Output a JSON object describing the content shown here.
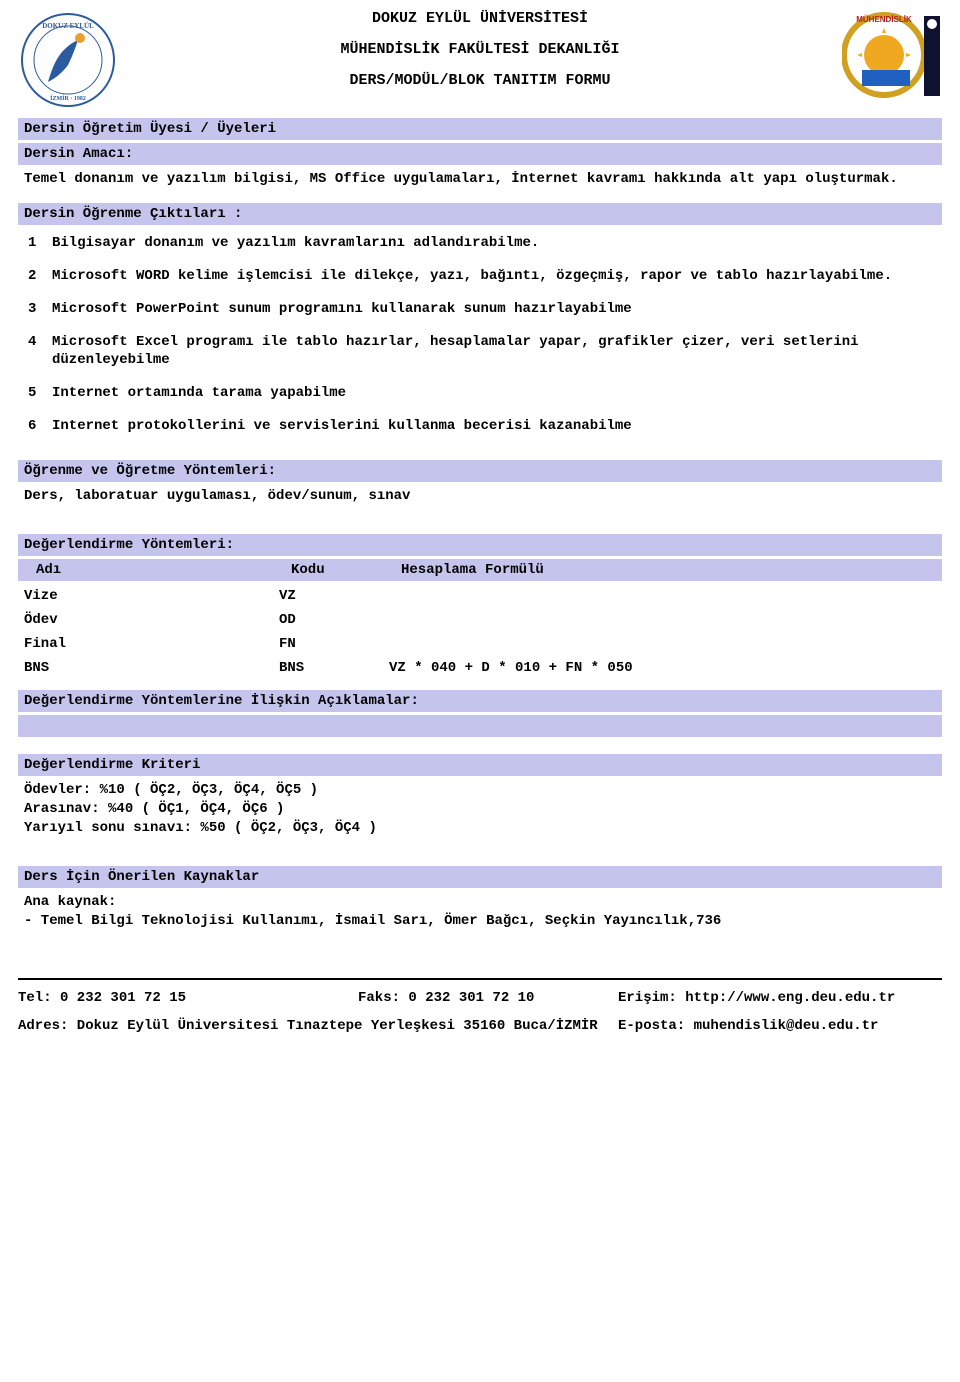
{
  "header": {
    "title1": "DOKUZ EYLÜL ÜNİVERSİTESİ",
    "title2": "MÜHENDİSLİK FAKÜLTESİ DEKANLIĞI",
    "title3": "DERS/MODÜL/BLOK TANITIM FORMU"
  },
  "sections": {
    "instructor_label": "Dersin Öğretim Üyesi / Üyeleri",
    "aim_label": "Dersin Amacı:",
    "aim_text": "Temel donanım ve yazılım bilgisi, MS Office uygulamaları, İnternet kavramı hakkında alt yapı oluşturmak.",
    "outcomes_label": "Dersin Öğrenme Çıktıları :",
    "outcomes": [
      {
        "n": "1",
        "text": "Bilgisayar donanım ve yazılım kavramlarını adlandırabilme."
      },
      {
        "n": "2",
        "text": "Microsoft WORD kelime işlemcisi ile dilekçe, yazı, bağıntı, özgeçmiş, rapor ve tablo hazırlayabilme."
      },
      {
        "n": "3",
        "text": "Microsoft PowerPoint sunum programını kullanarak sunum hazırlayabilme"
      },
      {
        "n": "4",
        "text": "Microsoft Excel programı ile tablo hazırlar, hesaplamalar yapar, grafikler çizer, veri setlerini düzenleyebilme"
      },
      {
        "n": "5",
        "text": "Internet ortamında tarama yapabilme"
      },
      {
        "n": "6",
        "text": "Internet protokollerini ve servislerini kullanma becerisi kazanabilme"
      }
    ],
    "methods_label": "Öğrenme ve Öğretme Yöntemleri:",
    "methods_text": "Ders, laboratuar uygulaması, ödev/sunum, sınav",
    "eval_label": "Değerlendirme Yöntemleri:",
    "eval_headers": {
      "c1": "Adı",
      "c2": "Kodu",
      "c3": "Hesaplama Formülü"
    },
    "eval_rows": [
      {
        "c1": "Vize",
        "c2": "VZ",
        "c3": ""
      },
      {
        "c1": "Ödev",
        "c2": "OD",
        "c3": ""
      },
      {
        "c1": "Final",
        "c2": "FN",
        "c3": ""
      },
      {
        "c1": "BNS",
        "c2": "BNS",
        "c3": "VZ * 040 + D * 010 + FN * 050"
      }
    ],
    "eval_notes_label": "Değerlendirme Yöntemlerine İlişkin Açıklamalar:",
    "criteria_label": "Değerlendirme Kriteri",
    "criteria_lines": [
      "Ödevler: %10 ( ÖÇ2, ÖÇ3, ÖÇ4, ÖÇ5 )",
      "Arasınav: %40 ( ÖÇ1, ÖÇ4, ÖÇ6 )",
      "Yarıyıl sonu sınavı: %50 ( ÖÇ2, ÖÇ3, ÖÇ4 )"
    ],
    "resources_label": "Ders İçin Önerilen Kaynaklar",
    "resources_title": "Ana kaynak:",
    "resources_line": "- Temel Bilgi Teknolojisi Kullanımı, İsmail Sarı, Ömer Bağcı, Seçkin Yayıncılık,736"
  },
  "footer": {
    "tel": "Tel: 0 232 301 72 15",
    "fax": "Faks: 0 232 301 72 10",
    "web": "Erişim: http://www.eng.deu.edu.tr",
    "addr": "Adres: Dokuz Eylül Üniversitesi Tınaztepe Yerleşkesi 35160 Buca/İZMİR",
    "email": "E-posta: muhendislik@deu.edu.tr"
  }
}
